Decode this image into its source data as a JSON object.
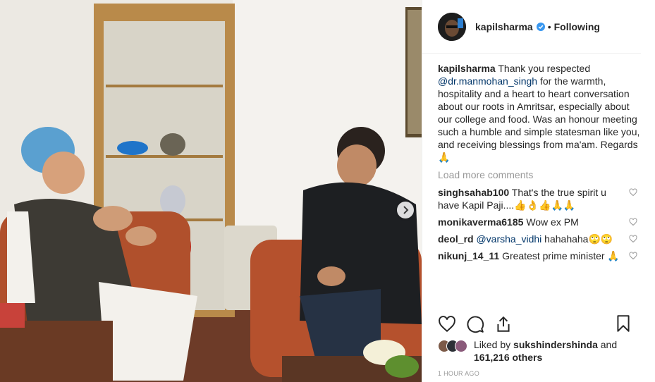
{
  "post": {
    "username": "kapilsharma",
    "dot": "•",
    "follow_state": "Following",
    "caption_user": "kapilsharma",
    "caption_part1": "Thank you respected",
    "caption_mention": "@dr.manmohan_singh",
    "caption_part2": "for the warmth, hospitality and a heart to heart conversation about our roots in Amritsar, especially about our college and food. Was an honour meeting such a humble and simple statesman like you, and receiving blessings from ma'am. Regards 🙏",
    "load_more": "Load more comments",
    "comments": [
      {
        "user": "singhsahab100",
        "text": "That's the true spirit u have Kapil Paji....👍👌👍🙏🙏"
      },
      {
        "user": "monikaverma6185",
        "text": "Wow ex PM"
      },
      {
        "user": "deol_rd",
        "mention": "@varsha_vidhi",
        "text": "hahahaha🙄🙄"
      },
      {
        "user": "nikunj_14_11",
        "text": "Greatest prime minister 🙏"
      }
    ],
    "liked_by_prefix": "Liked by",
    "liked_by_user": "sukshindershinda",
    "liked_by_and": "and",
    "likes_count": "161,216 others",
    "timestamp": "1 HOUR AGO"
  },
  "icons": {
    "verified": "verified-badge-icon",
    "heart": "heart-icon",
    "comment": "comment-icon",
    "share": "share-icon",
    "save": "bookmark-icon",
    "next": "chevron-right-icon"
  },
  "colors": {
    "verified_blue": "#3897f0",
    "mention_blue": "#003569",
    "muted_gray": "#999999",
    "text": "#262626"
  }
}
